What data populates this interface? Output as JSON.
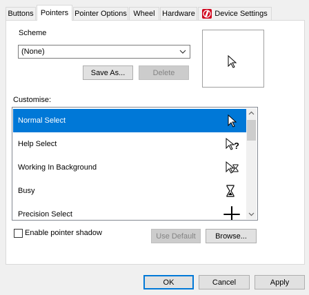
{
  "tabs": [
    {
      "label": "Buttons"
    },
    {
      "label": "Pointers"
    },
    {
      "label": "Pointer Options"
    },
    {
      "label": "Wheel"
    },
    {
      "label": "Hardware"
    },
    {
      "label": "Device Settings",
      "icon": "device-settings-icon"
    }
  ],
  "active_tab": "Pointers",
  "scheme": {
    "label": "Scheme",
    "selected": "(None)",
    "save_as_label": "Save As...",
    "delete_label": "Delete"
  },
  "customise": {
    "label": "Customise:",
    "items": [
      {
        "label": "Normal Select",
        "icon": "arrow-cursor-icon",
        "selected": true
      },
      {
        "label": "Help Select",
        "icon": "help-cursor-icon"
      },
      {
        "label": "Working In Background",
        "icon": "working-cursor-icon"
      },
      {
        "label": "Busy",
        "icon": "hourglass-icon"
      },
      {
        "label": "Precision Select",
        "icon": "crosshair-icon"
      }
    ]
  },
  "shadow_checkbox": {
    "label": "Enable pointer shadow",
    "checked": false
  },
  "use_default_label": "Use Default",
  "browse_label": "Browse...",
  "footer": {
    "ok": "OK",
    "cancel": "Cancel",
    "apply": "Apply"
  },
  "colors": {
    "accent": "#0078d7",
    "device_icon": "#d0021b"
  }
}
